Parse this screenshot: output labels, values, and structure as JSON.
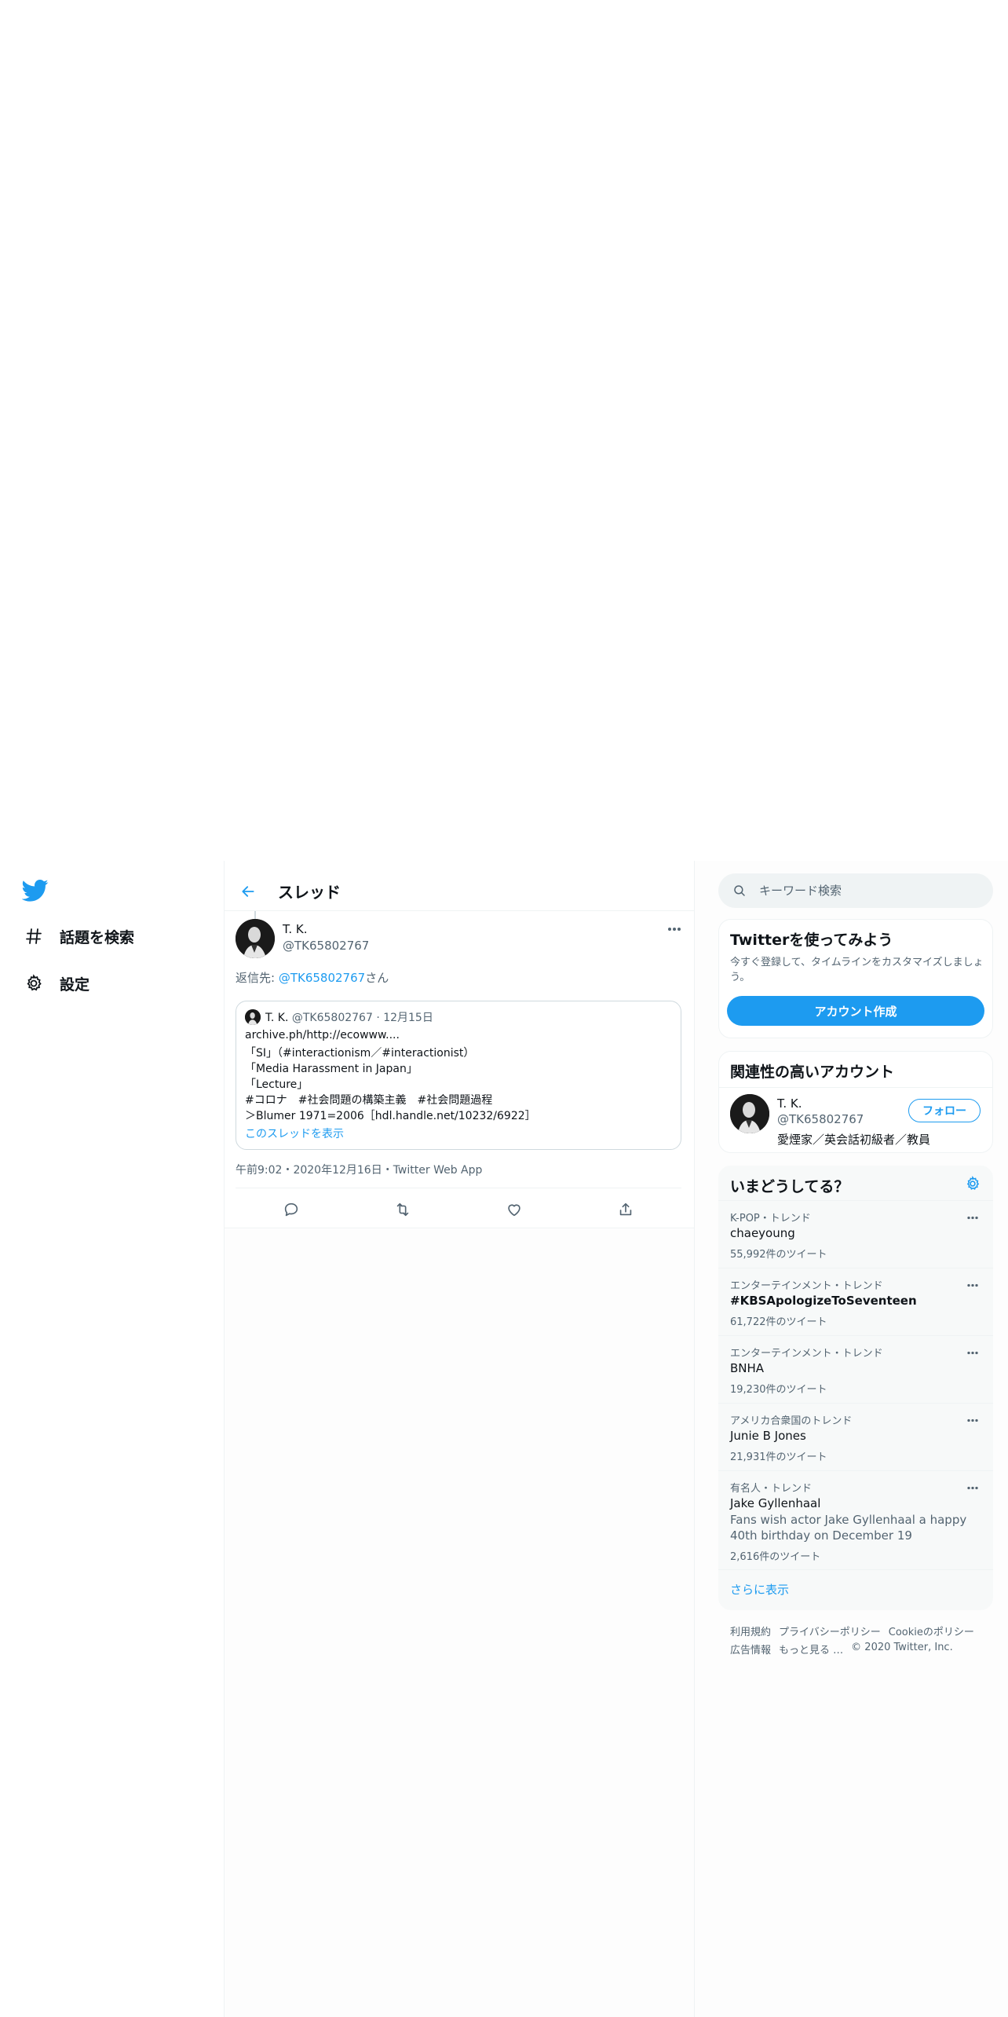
{
  "nav": {
    "explore_label": "話題を検索",
    "settings_label": "設定"
  },
  "header": {
    "title": "スレッド"
  },
  "tweet": {
    "name": "T. K.",
    "handle": "@TK65802767",
    "reply_prefix": "返信先: ",
    "reply_mention": "@TK65802767",
    "reply_suffix": "さん",
    "quote": {
      "name": "T. K.",
      "meta": "@TK65802767 · 12月15日",
      "lines": [
        "archive.ph/http://ecowww....",
        "「SI」（#interactionism／#interactionist）",
        "「Media Harassment in Japan」",
        "「Lecture」",
        "#コロナ　#社会問題の構築主義　#社会問題過程",
        "＞Blumer 1971=2006［hdl.handle.net/10232/6922］"
      ],
      "show_thread": "このスレッドを表示"
    },
    "timestamp": "午前9:02・2020年12月16日・Twitter Web App"
  },
  "search": {
    "placeholder": "キーワード検索"
  },
  "signup": {
    "title": "Twitterを使ってみよう",
    "desc": "今すぐ登録して、タイムラインをカスタマイズしましょう。",
    "button": "アカウント作成"
  },
  "related": {
    "title": "関連性の高いアカウント",
    "name": "T. K.",
    "handle": "@TK65802767",
    "bio": "愛煙家／英会話初級者／教員",
    "follow": "フォロー"
  },
  "trends": {
    "title": "いまどうしてる？",
    "items": [
      {
        "context": "K-POP・トレンド",
        "name": "chaeyoung",
        "count": "55,992件のツイート"
      },
      {
        "context": "エンターテインメント・トレンド",
        "name": "#KBSApologizeToSeventeen",
        "count": "61,722件のツイート"
      },
      {
        "context": "エンターテインメント・トレンド",
        "name": "BNHA",
        "count": "19,230件のツイート"
      },
      {
        "context": "アメリカ合衆国のトレンド",
        "name": "Junie B Jones",
        "count": "21,931件のツイート"
      },
      {
        "context": "有名人・トレンド",
        "name": "Jake Gyllenhaal",
        "desc": "Fans wish actor Jake Gyllenhaal a happy 40th birthday on December 19",
        "count": "2,616件のツイート"
      }
    ],
    "show_more": "さらに表示"
  },
  "footer": {
    "terms": "利用規約",
    "privacy": "プライバシーポリシー",
    "cookie": "Cookieのポリシー",
    "ads": "広告情報",
    "more": "もっと見る",
    "copyright": "© 2020 Twitter, Inc."
  },
  "colors": {
    "accent": "#1d9bf0",
    "secondary_text": "#536471"
  }
}
